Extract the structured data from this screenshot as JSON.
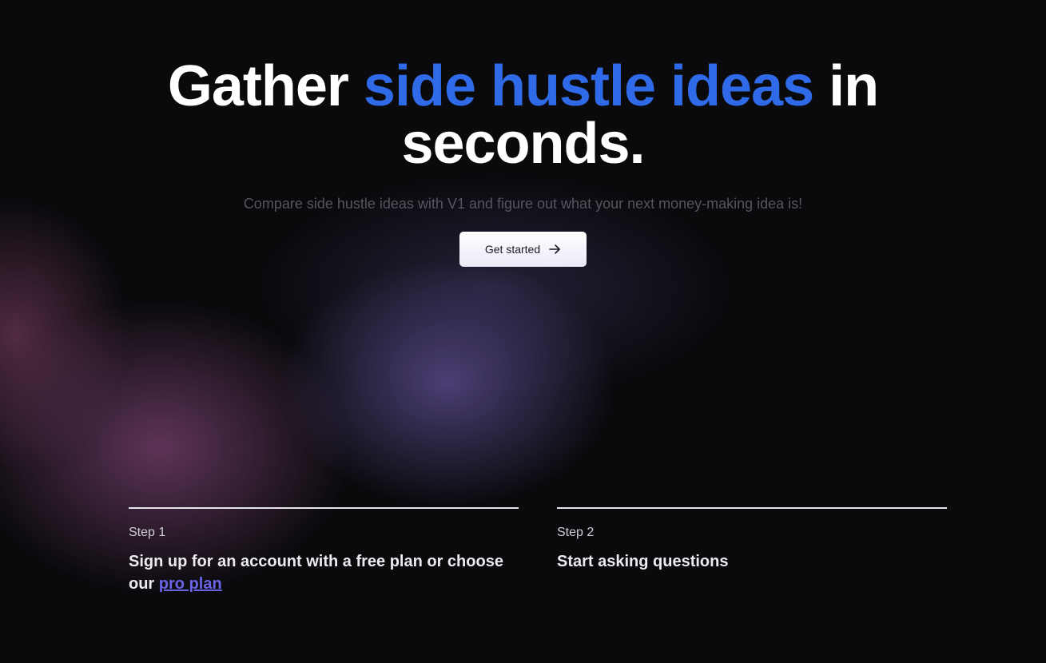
{
  "hero": {
    "headline_part1": "Gather ",
    "headline_accent": "side hustle ideas",
    "headline_part2": " in seconds.",
    "subtitle": "Compare side hustle ideas with V1 and figure out what your next money-making idea is!",
    "cta_label": "Get started",
    "cta_icon": "arrow-right-icon"
  },
  "steps": [
    {
      "label": "Step 1",
      "title_text": "Sign up for an account with a free plan or choose our ",
      "link_text": "pro plan"
    },
    {
      "label": "Step 2",
      "title_text": "Start asking questions"
    }
  ],
  "colors": {
    "background": "#0a0a0d",
    "accent": "#2f6be8",
    "link": "#6a64e8"
  }
}
